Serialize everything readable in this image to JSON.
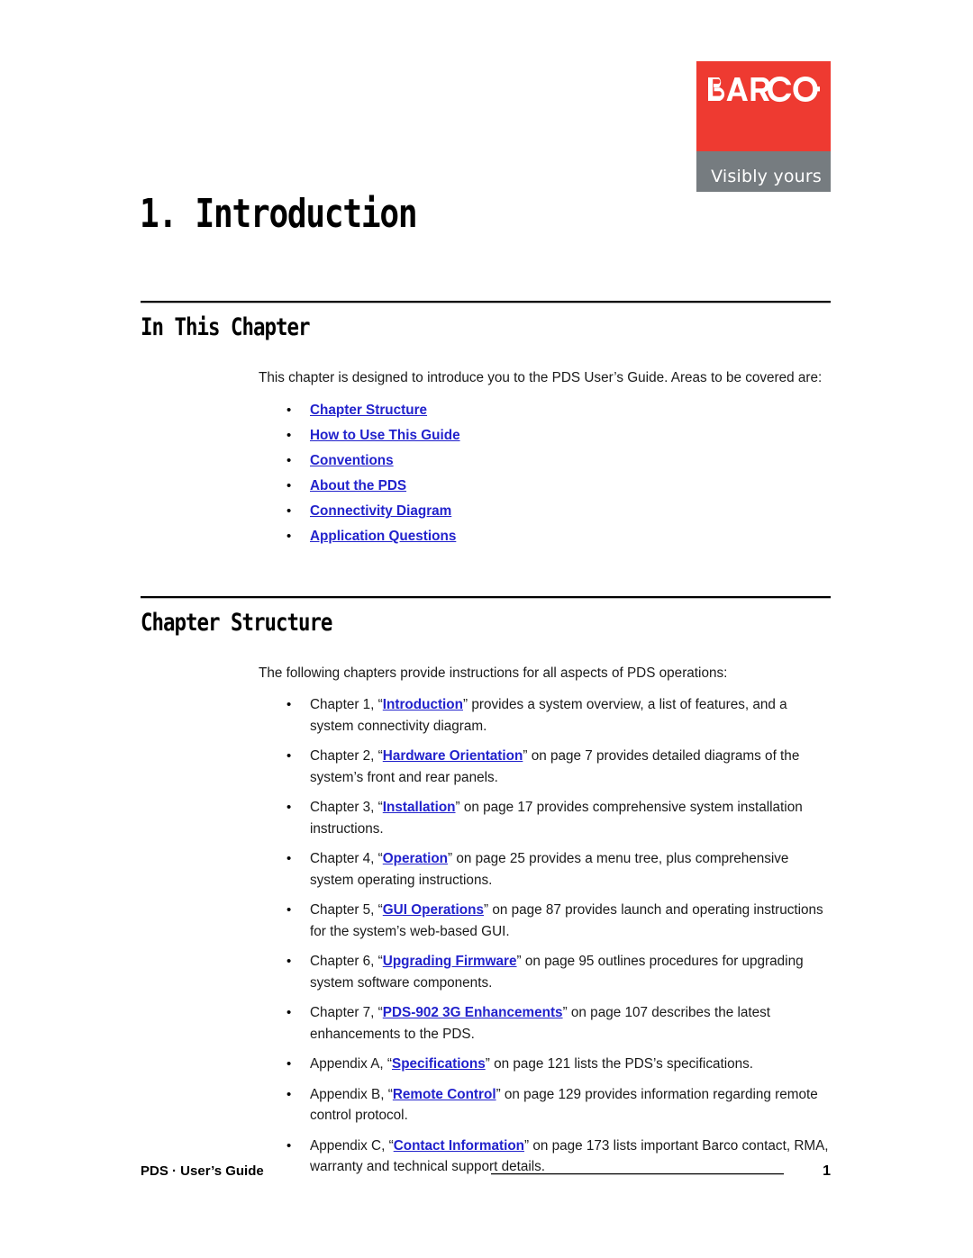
{
  "logo": {
    "wordmark": "BARCO",
    "tagline": "Visibly yours",
    "red": "#ee3a31",
    "gray": "#767c80"
  },
  "chapter_title": "1. Introduction",
  "link_color": "#2222cc",
  "sections": [
    {
      "heading": "In This Chapter",
      "intro": "This chapter is designed to introduce you to the PDS User’s Guide. Areas to be covered are:",
      "links": [
        "Chapter Structure",
        "How to Use This Guide",
        "Conventions",
        "About the PDS",
        "Connectivity Diagram",
        "Application Questions"
      ]
    },
    {
      "heading": "Chapter Structure",
      "intro": "The following chapters provide instructions for all aspects of PDS operations:",
      "items": [
        {
          "pre": "Chapter 1, “",
          "link": "Introduction",
          "post": "” provides a system overview, a list of features, and a system connectivity diagram."
        },
        {
          "pre": "Chapter 2, “",
          "link": "Hardware Orientation",
          "post": "” on page 7 provides detailed diagrams of the system’s front and rear panels."
        },
        {
          "pre": "Chapter 3, “",
          "link": "Installation",
          "post": "” on page 17 provides comprehensive system installation instructions."
        },
        {
          "pre": "Chapter 4, “",
          "link": "Operation",
          "post": "” on page 25 provides a menu tree, plus comprehensive system operating instructions."
        },
        {
          "pre": "Chapter 5, “",
          "link": "GUI Operations",
          "post": "” on page 87 provides launch and operating instructions for the system’s web-based GUI."
        },
        {
          "pre": "Chapter 6, “",
          "link": "Upgrading Firmware",
          "post": "” on page 95 outlines procedures for upgrading system software components."
        },
        {
          "pre": "Chapter 7, “",
          "link": "PDS-902 3G Enhancements",
          "post": "” on page 107 describes the latest enhancements to the PDS."
        },
        {
          "pre": "Appendix A, “",
          "link": "Specifications",
          "post": "” on page 121 lists the PDS’s specifications."
        },
        {
          "pre": "Appendix B, “",
          "link": "Remote Control",
          "post": "” on page 129 provides information regarding remote control protocol."
        },
        {
          "pre": "Appendix C, “",
          "link": "Contact Information",
          "post": "” on page 173 lists important Barco contact, RMA, warranty and technical support details."
        }
      ]
    }
  ],
  "footer": {
    "left": "PDS · User’s Guide",
    "page_number": "1"
  }
}
